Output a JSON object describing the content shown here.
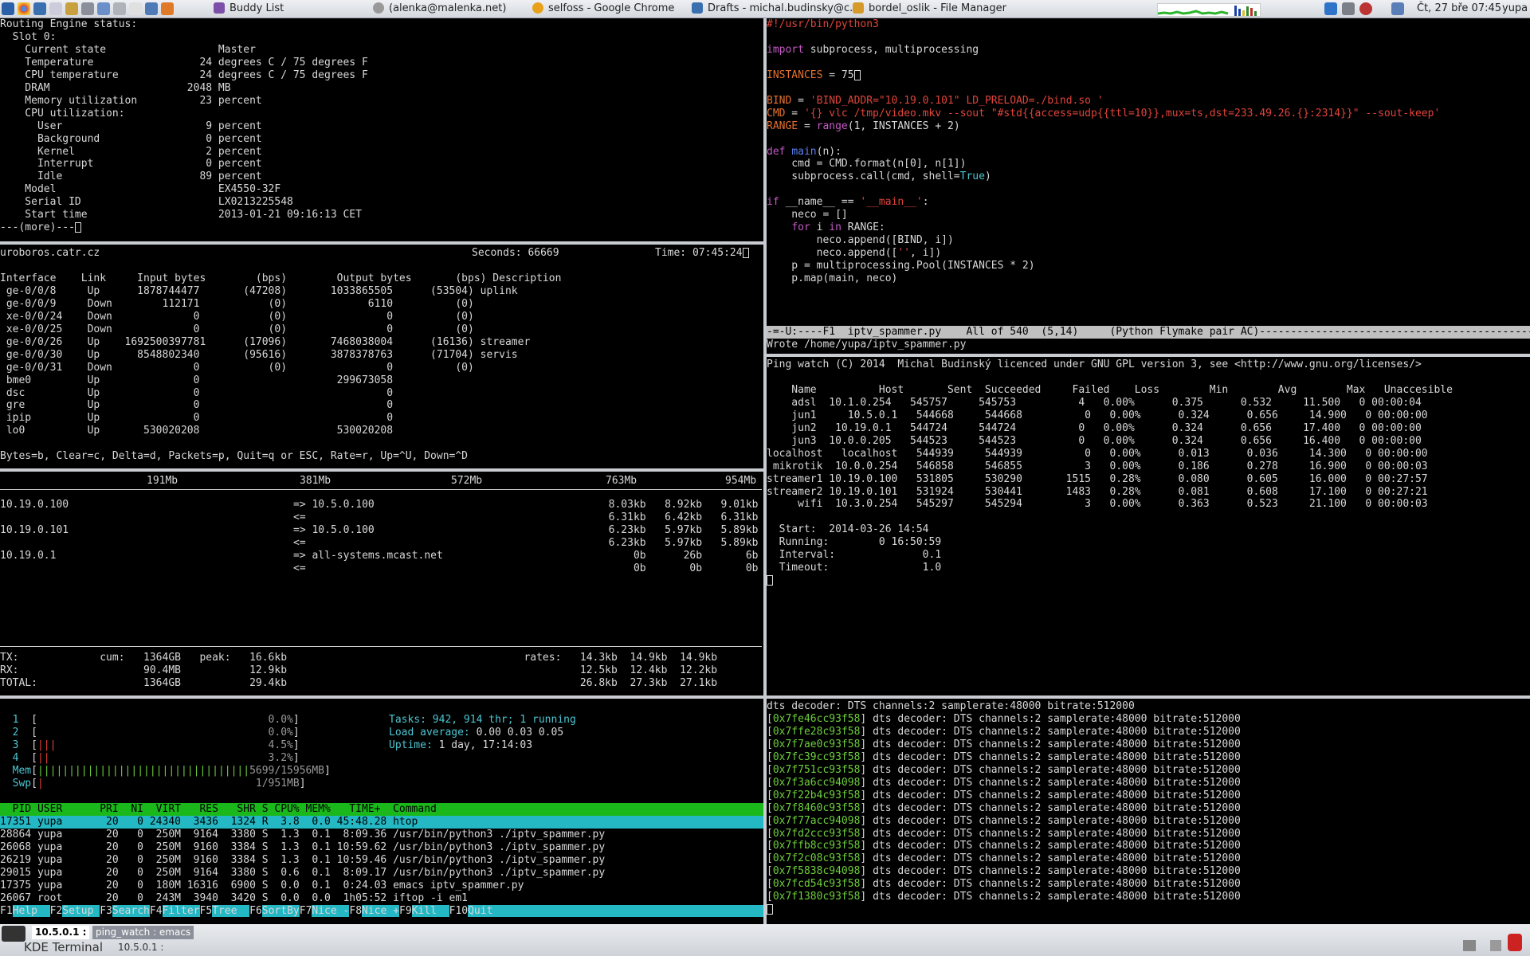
{
  "topbar": {
    "tasks": [
      {
        "label": "Buddy List",
        "icon": "pidgin-icon",
        "color": "#7c4fa8"
      },
      {
        "label": "(alenka@malenka.net)",
        "icon": "close-icon",
        "color": "#888888"
      },
      {
        "label": "selfoss - Google Chrome",
        "icon": "chrome-icon",
        "color": "#e8a11a"
      },
      {
        "label": "Drafts - michal.budinsky@c...",
        "icon": "thunderbird-icon",
        "color": "#3a6fb0"
      },
      {
        "label": "bordel_oslik - File Manager",
        "icon": "folder-icon",
        "color": "#d69a2b"
      }
    ],
    "clock": "Čt, 27 bře 07:45",
    "user": "yupa"
  },
  "junos": {
    "lines": [
      "Routing Engine status:",
      "  Slot 0:",
      "    Current state                  Master",
      "    Temperature                 24 degrees C / 75 degrees F",
      "    CPU temperature             24 degrees C / 75 degrees F",
      "    DRAM                      2048 MB",
      "    Memory utilization          23 percent",
      "    CPU utilization:",
      "      User                       9 percent",
      "      Background                 0 percent",
      "      Kernel                     2 percent",
      "      Interrupt                  0 percent",
      "      Idle                      89 percent",
      "    Model                          EX4550-32F",
      "    Serial ID                      LX0213225548",
      "    Start time                     2013-01-21 09:16:13 CET"
    ],
    "more": "---(more)---"
  },
  "monitor": {
    "host": "uroboros.catr.cz",
    "seconds": "Seconds: 66669",
    "time": "Time: 07:45:24",
    "header": "Interface    Link     Input bytes        (bps)        Output bytes       (bps) Description",
    "rows": [
      " ge-0/0/8     Up      1878744477       (47208)       1033865505      (53504) uplink",
      " ge-0/0/9     Down        112171           (0)             6110          (0)",
      " xe-0/0/24    Down             0           (0)                0          (0)",
      " xe-0/0/25    Down             0           (0)                0          (0)",
      " ge-0/0/26    Up    1692500397781      (17096)       7468038004      (16136) streamer",
      " ge-0/0/30    Up      8548802340       (95616)       3878378763      (71704) servis",
      " ge-0/0/31    Down             0           (0)                0          (0)",
      " bme0         Up               0                      299673058",
      " dsc          Up               0                              0",
      " gre          Up               0                              0",
      " ipip         Up               0                              0",
      " lo0          Up       530020208                      530020208"
    ],
    "help": "Bytes=b, Clear=c, Delta=d, Packets=p, Quit=q or ESC, Rate=r, Up=^U, Down=^D"
  },
  "iftop": {
    "scale": [
      "191Mb",
      "381Mb",
      "572Mb",
      "763Mb",
      "954Mb"
    ],
    "flows": [
      {
        "src": "10.19.0.100",
        "dst": "=> 10.5.0.100",
        "r1": "8.03kb",
        "r2": "8.92kb",
        "r3": "9.01kb"
      },
      {
        "src": "",
        "dst": "<=",
        "r1": "6.31kb",
        "r2": "6.42kb",
        "r3": "6.31kb"
      },
      {
        "src": "10.19.0.101",
        "dst": "=> 10.5.0.100",
        "r1": "6.23kb",
        "r2": "5.97kb",
        "r3": "5.89kb"
      },
      {
        "src": "",
        "dst": "<=",
        "r1": "6.23kb",
        "r2": "5.97kb",
        "r3": "5.89kb"
      },
      {
        "src": "10.19.0.1",
        "dst": "=> all-systems.mcast.net",
        "r1": "0b",
        "r2": "26b",
        "r3": "6b"
      },
      {
        "src": "",
        "dst": "<=",
        "r1": "0b",
        "r2": "0b",
        "r3": "0b"
      }
    ],
    "totals": [
      "TX:             cum:   1364GB   peak:   16.6kb                                      rates:   14.3kb  14.9kb  14.9kb",
      "RX:                    90.4MB           12.9kb                                               12.5kb  12.4kb  12.2kb",
      "TOTAL:                 1364GB           29.4kb                                               26.8kb  27.3kb  27.1kb"
    ]
  },
  "htop": {
    "cpus": [
      {
        "n": "1",
        "bar": "",
        "pct": "0.0%"
      },
      {
        "n": "2",
        "bar": "",
        "pct": "0.0%"
      },
      {
        "n": "3",
        "bar": "|||",
        "pct": "4.5%"
      },
      {
        "n": "4",
        "bar": "||",
        "pct": "3.2%"
      }
    ],
    "mem": "5699/15956MB",
    "swp": "1/951MB",
    "tasks_label": "Tasks:",
    "tasks": "942, 914 thr; 1 running",
    "load_label": "Load average:",
    "load": "0.00 0.03 0.05",
    "uptime_label": "Uptime:",
    "uptime": "1 day, 17:14:03",
    "header": "  PID USER      PRI  NI  VIRT   RES   SHR S CPU% MEM%   TIME+  Command",
    "selected": "17351 yupa       20   0 24340  3436  1324 R  3.8  0.0 45:48.28 htop",
    "procs": [
      "28864 yupa       20   0  250M  9164  3380 S  1.3  0.1  8:09.36 /usr/bin/python3 ./iptv_spammer.py",
      "26068 yupa       20   0  250M  9160  3384 S  1.3  0.1 10:59.62 /usr/bin/python3 ./iptv_spammer.py",
      "26219 yupa       20   0  250M  9160  3384 S  1.3  0.1 10:59.46 /usr/bin/python3 ./iptv_spammer.py",
      "29015 yupa       20   0  250M  9164  3380 S  0.6  0.1  8:09.17 /usr/bin/python3 ./iptv_spammer.py",
      "17375 yupa       20   0  180M 16316  6900 S  0.0  0.1  0:24.03 emacs iptv_spammer.py",
      "26067 root       20   0  243M  3940  3420 S  0.0  0.0  1h05:52 iftop -i em1"
    ],
    "fkeys": [
      {
        "k": "F1",
        "l": "Help  "
      },
      {
        "k": "F2",
        "l": "Setup "
      },
      {
        "k": "F3",
        "l": "Search"
      },
      {
        "k": "F4",
        "l": "Filter"
      },
      {
        "k": "F5",
        "l": "Tree  "
      },
      {
        "k": "F6",
        "l": "SortBy"
      },
      {
        "k": "F7",
        "l": "Nice -"
      },
      {
        "k": "F8",
        "l": "Nice +"
      },
      {
        "k": "F9",
        "l": "Kill  "
      },
      {
        "k": "F10",
        "l": "Quit  "
      }
    ]
  },
  "emacs": {
    "shebang": "#!/usr/bin/python3",
    "modeline": "-=-U:----F1  iptv_spammer.py    All of 540  (5,14)     (Python Flymake pair AC)--------------------------------------------------------------------------------",
    "echo": "Wrote /home/yupa/iptv_spammer.py"
  },
  "ping": {
    "title": "Ping watch (C) 2014  Michal Budinský licenced under GNU GPL version 3, see <http://www.gnu.org/licenses/>",
    "header": "    Name          Host       Sent  Succeeded     Failed    Loss        Min        Avg        Max   Unaccesible",
    "rows": [
      "    adsl  10.1.0.254   545757     545753          4   0.00%      0.375      0.532     11.500   0 00:00:04",
      "    jun1     10.5.0.1   544668     544668          0   0.00%      0.324      0.656     14.900   0 00:00:00",
      "    jun2   10.19.0.1   544724     544724          0   0.00%      0.324      0.656     17.400   0 00:00:00",
      "    jun3  10.0.0.205   544523     544523          0   0.00%      0.324      0.656     16.400   0 00:00:00",
      "localhost   localhost   544939     544939          0   0.00%      0.013      0.036     14.300   0 00:00:00",
      " mikrotik  10.0.0.254   546858     546855          3   0.00%      0.186      0.278     16.900   0 00:00:03",
      "streamer1 10.19.0.100   531805     530290       1515   0.28%      0.080      0.605     16.000   0 00:27:57",
      "streamer2 10.19.0.101   531924     530441       1483   0.28%      0.081      0.608     17.100   0 00:27:21",
      "     wifi  10.3.0.254   545297     545294          3   0.00%      0.363      0.523     21.100   0 00:00:03"
    ],
    "stats": [
      "  Start:  2014-03-26 14:54",
      "  Running:        0 16:50:59",
      "  Interval:              0.1",
      "  Timeout:               1.0"
    ]
  },
  "vlc": {
    "first": "dts decoder: DTS channels:2 samplerate:48000 bitrate:512000",
    "msg": "dts decoder: DTS channels:2 samplerate:48000 bitrate:512000",
    "addrs": [
      "0x7fe46cc93f58",
      "0x7ffe28c93f58",
      "0x7f7ae0c93f58",
      "0x7fc39cc93f58",
      "0x7f751cc93f58",
      "0x7f3a6cc94098",
      "0x7f22b4c93f58",
      "0x7f8460c93f58",
      "0x7f77acc94098",
      "0x7fd2ccc93f58",
      "0x7ffb8cc93f58",
      "0x7f2c08c93f58",
      "0x7f5838c94098",
      "0x7fcd54c93f58",
      "0x7f1380c93f58"
    ]
  },
  "bottom": {
    "tab1": "10.5.0.1 :",
    "tab2": "ping_watch : emacs",
    "app": "KDE Terminal",
    "subtitle": "10.5.0.1 :"
  }
}
